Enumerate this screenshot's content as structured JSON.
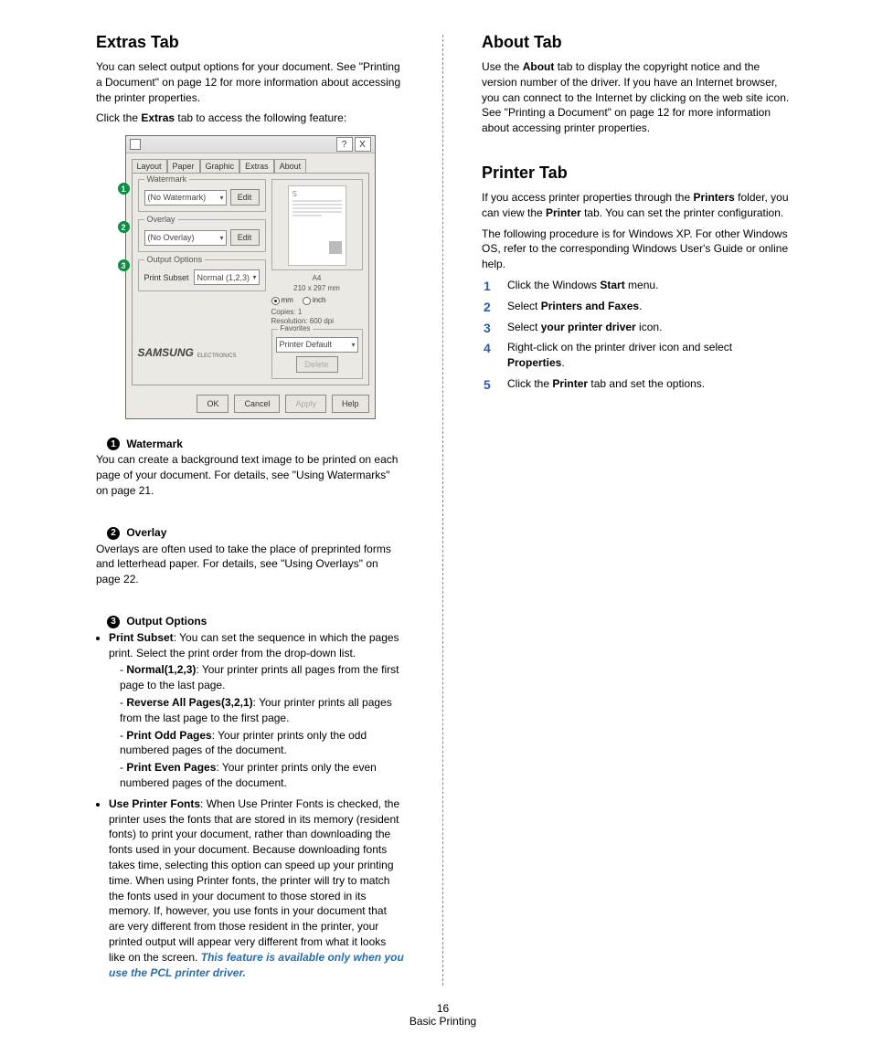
{
  "left": {
    "h_extras": "Extras Tab",
    "p1": "You can select output options for your document. See \"Printing a Document\" on page 12 for more information about accessing the printer properties.",
    "p2_a": "Click the ",
    "p2_b": "Extras",
    "p2_c": " tab to access the following feature:",
    "sec1_title": "Watermark",
    "sec1_p": "You can create a background text image to be printed on each page of your document. For details, see \"Using Watermarks\" on page 21.",
    "sec2_title": "Overlay",
    "sec2_p": "Overlays are often used to take the place of preprinted forms and letterhead paper. For details, see \"Using Overlays\" on page 22.",
    "sec3_title": "Output Options",
    "bul1_a": "Print Subset",
    "bul1_b": ": You can set the sequence in which the pages print. Select the print order from the drop-down list.",
    "sub1_a": "Normal(1,2,3)",
    "sub1_b": ": Your printer prints all pages from the first page to the last page.",
    "sub2_a": "Reverse All Pages(3,2,1)",
    "sub2_b": ": Your printer prints all pages from the last page to the first page.",
    "sub3_a": "Print Odd Pages",
    "sub3_b": ": Your printer prints only the odd numbered pages of the document.",
    "sub4_a": "Print Even Pages",
    "sub4_b": ": Your printer prints only the even numbered pages of the document.",
    "bul2_a": "Use Printer Fonts",
    "bul2_b": ": When Use Printer Fonts is checked, the printer uses the fonts that are stored in its memory (resident fonts) to print your document, rather than downloading the fonts used in your document. Because downloading fonts takes time, selecting this option can speed up your printing time. When using Printer fonts, the printer will try to match the fonts used in your document to those stored in its memory. If, however, you use fonts in your document that are very different from those resident in the printer, your printed output will appear very different from what it looks like on the screen.",
    "bul2_pcl": "This feature is available only when you use the PCL printer driver."
  },
  "dialog": {
    "tab1": "Layout",
    "tab2": "Paper",
    "tab3": "Graphic",
    "tab4": "Extras",
    "tab5": "About",
    "g1": "Watermark",
    "g1v": "(No Watermark)",
    "edit": "Edit",
    "g2": "Overlay",
    "g2v": "(No Overlay)",
    "g3": "Output Options",
    "g3l": "Print Subset",
    "g3v": "Normal (1,2,3)",
    "s": "S",
    "pA": "A4",
    "pB": "210 x 297 mm",
    "rmm": "mm",
    "rin": "inch",
    "i1": "Copies: 1",
    "i2": "Resolution: 600 dpi",
    "fav": "Favorites",
    "favv": "Printer Default",
    "del": "Delete",
    "logo": "SAMSUNG",
    "sublogo": "ELECTRONICS",
    "ok": "OK",
    "cancel": "Cancel",
    "apply": "Apply",
    "help": "Help",
    "c1": "1",
    "c2": "2",
    "c3": "3",
    "q": "?",
    "x": "X"
  },
  "right": {
    "h_about": "About Tab",
    "about_a": "Use the ",
    "about_b": "About",
    "about_c": " tab to display the copyright notice and the version number of the driver. If you have an Internet browser, you can connect to the Internet by clicking on the web site icon. See \"Printing a Document\" on page 12 for more information about accessing printer properties.",
    "h_printer": "Printer Tab",
    "printer_p1_a": "If you access printer properties through the ",
    "printer_p1_b": "Printers",
    "printer_p1_c": " folder, you can view the ",
    "printer_p1_d": "Printer",
    "printer_p1_e": " tab. You can set the printer configuration.",
    "printer_p2": "The following procedure is for Windows XP. For other Windows OS, refer to the corresponding Windows User's Guide or online help.",
    "s1a": "Click the Windows ",
    "s1b": "Start",
    "s1c": " menu.",
    "s2a": "Select ",
    "s2b": "Printers and Faxes",
    "s2c": ".",
    "s3a": "Select ",
    "s3b": "your printer driver",
    "s3c": " icon.",
    "s4a": "Right-click on the printer driver icon and select ",
    "s4b": "Properties",
    "s4c": ".",
    "s5a": "Click the ",
    "s5b": "Printer",
    "s5c": " tab and set the options.",
    "n1": "1",
    "n2": "2",
    "n3": "3",
    "n4": "4",
    "n5": "5"
  },
  "badges": {
    "b1": "1",
    "b2": "2",
    "b3": "3"
  },
  "footer": {
    "page": "16",
    "section": "Basic Printing"
  }
}
